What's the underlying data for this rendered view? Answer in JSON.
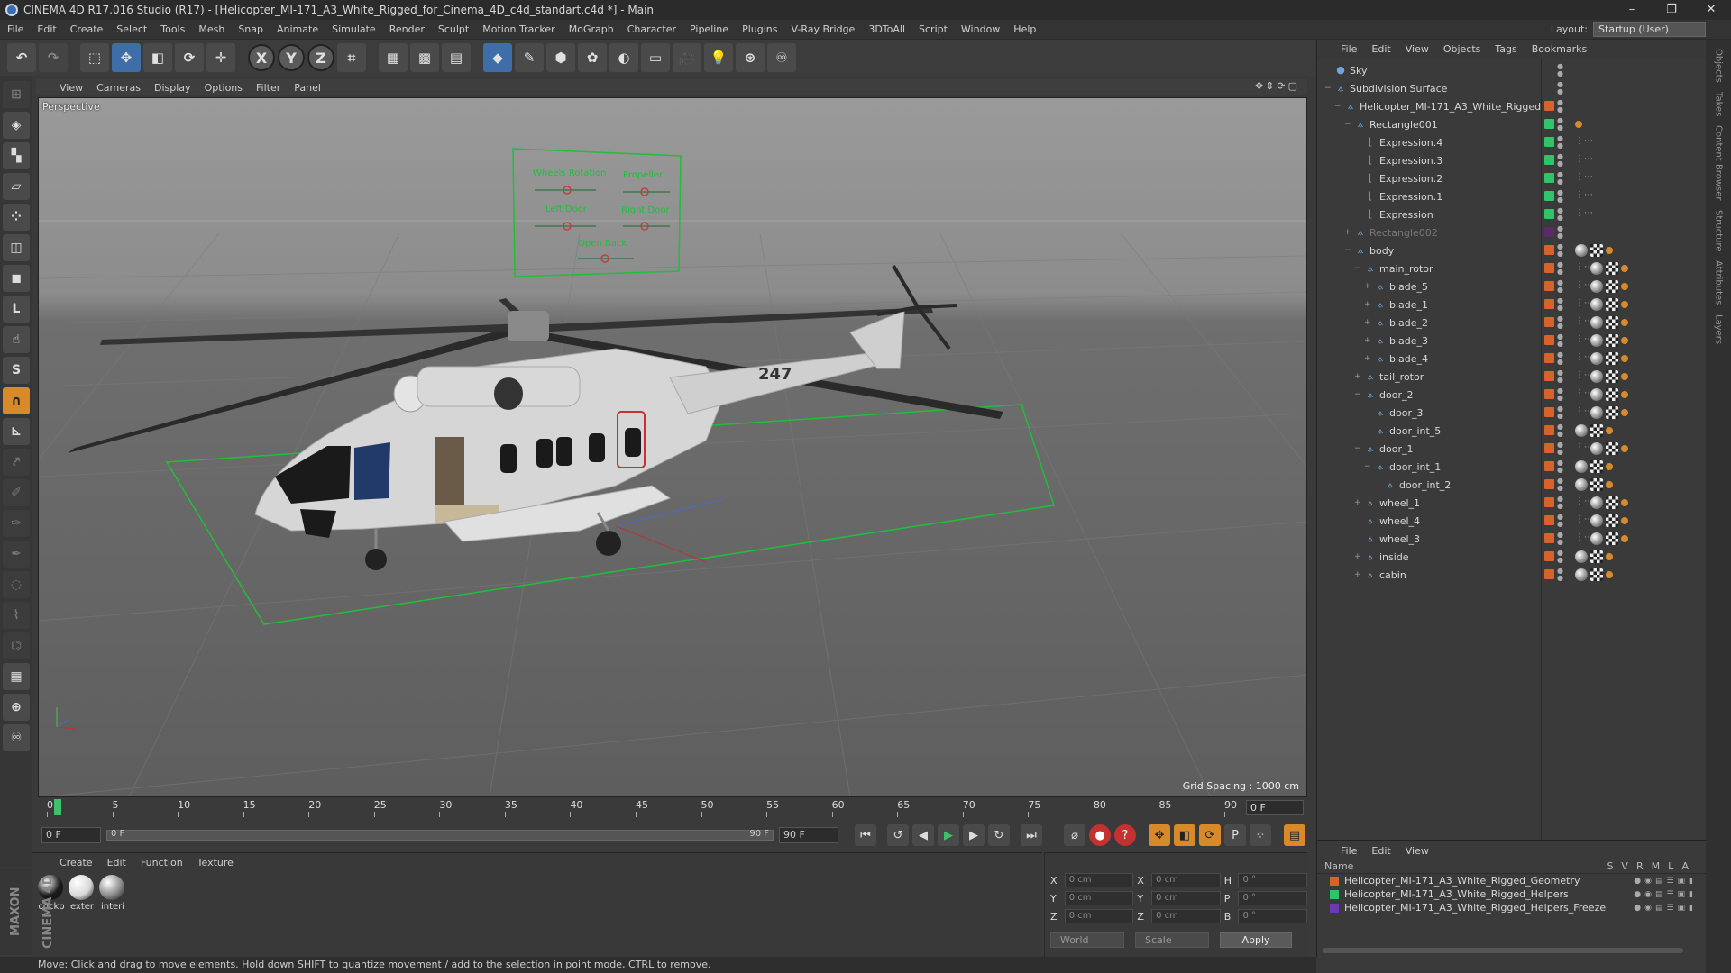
{
  "titlebar": {
    "title": "CINEMA 4D R17.016 Studio (R17) - [Helicopter_MI-171_A3_White_Rigged_for_Cinema_4D_c4d_standart.c4d *] - Main"
  },
  "menubar": {
    "items": [
      "File",
      "Edit",
      "Create",
      "Select",
      "Tools",
      "Mesh",
      "Snap",
      "Animate",
      "Simulate",
      "Render",
      "Sculpt",
      "Motion Tracker",
      "MoGraph",
      "Character",
      "Pipeline",
      "Plugins",
      "V-Ray Bridge",
      "3DToAll",
      "Script",
      "Window",
      "Help"
    ],
    "layout_label": "Layout:",
    "layout_value": "Startup (User)"
  },
  "toolbar": {
    "axis_x": "X",
    "axis_y": "Y",
    "axis_z": "Z"
  },
  "viewport": {
    "menu": [
      "View",
      "Cameras",
      "Display",
      "Options",
      "Filter",
      "Panel"
    ],
    "label": "Perspective",
    "grid_spacing": "Grid Spacing : 1000 cm",
    "rig_labels": [
      "Wheels Rotation",
      "Propeller",
      "Left Door",
      "Right Door",
      "Open Back"
    ],
    "tail_number": "247",
    "colors": {
      "grid_green": "#1fbf3a",
      "hud_green": "#1fbf3a"
    }
  },
  "timeline": {
    "ticks": [
      "0",
      "5",
      "10",
      "15",
      "20",
      "25",
      "30",
      "35",
      "40",
      "45",
      "50",
      "55",
      "60",
      "65",
      "70",
      "75",
      "80",
      "85",
      "90"
    ],
    "current_frame": "0 F"
  },
  "transport": {
    "start_field": "0 F",
    "slider_start": "0 F",
    "slider_end": "90 F",
    "end_field": "90 F"
  },
  "materials": {
    "menu": [
      "Create",
      "Edit",
      "Function",
      "Texture"
    ],
    "items": [
      {
        "label": "cockp",
        "color": "#1a1a1a"
      },
      {
        "label": "exter",
        "color": "#d8d8d8"
      },
      {
        "label": "interi",
        "color": "#8a8a8a"
      }
    ]
  },
  "coordinates": {
    "rows": [
      {
        "a": "X",
        "av": "0 cm",
        "b": "X",
        "bv": "0 cm",
        "c": "H",
        "cv": "0 °"
      },
      {
        "a": "Y",
        "av": "0 cm",
        "b": "Y",
        "bv": "0 cm",
        "c": "P",
        "cv": "0 °"
      },
      {
        "a": "Z",
        "av": "0 cm",
        "b": "Z",
        "bv": "0 cm",
        "c": "B",
        "cv": "0 °"
      }
    ],
    "mode": "World",
    "scale": "Scale",
    "apply": "Apply"
  },
  "status": {
    "text": "Move: Click and drag to move elements. Hold down SHIFT to quantize movement / add to the selection in point mode, CTRL to remove."
  },
  "brand": {
    "text": "MAXON CINEMA 4D"
  },
  "objects": {
    "menu": [
      "File",
      "Edit",
      "View",
      "Objects",
      "Tags",
      "Bookmarks"
    ],
    "rows": [
      {
        "name": "Sky",
        "indent": 0,
        "exp": "",
        "swatch": "",
        "dim": false,
        "tags": []
      },
      {
        "name": "Subdivision Surface",
        "indent": 0,
        "exp": "−",
        "swatch": "",
        "dim": false,
        "tags": []
      },
      {
        "name": "Helicopter_MI-171_A3_White_Rigged",
        "indent": 1,
        "exp": "−",
        "swatch": "#d8632a",
        "dim": false,
        "tags": []
      },
      {
        "name": "Rectangle001",
        "indent": 2,
        "exp": "−",
        "swatch": "#2fc46a",
        "dim": false,
        "tags": [
          "ph"
        ]
      },
      {
        "name": "Expression.4",
        "indent": 3,
        "exp": "",
        "swatch": "#2fc46a",
        "dim": false,
        "tags": [
          "expr"
        ]
      },
      {
        "name": "Expression.3",
        "indent": 3,
        "exp": "",
        "swatch": "#2fc46a",
        "dim": false,
        "tags": [
          "expr"
        ]
      },
      {
        "name": "Expression.2",
        "indent": 3,
        "exp": "",
        "swatch": "#2fc46a",
        "dim": false,
        "tags": [
          "expr"
        ]
      },
      {
        "name": "Expression.1",
        "indent": 3,
        "exp": "",
        "swatch": "#2fc46a",
        "dim": false,
        "tags": [
          "expr"
        ]
      },
      {
        "name": "Expression",
        "indent": 3,
        "exp": "",
        "swatch": "#2fc46a",
        "dim": false,
        "tags": [
          "expr"
        ]
      },
      {
        "name": "Rectangle002",
        "indent": 2,
        "exp": "+",
        "swatch": "#5a2a6a",
        "dim": true,
        "tags": []
      },
      {
        "name": "body",
        "indent": 2,
        "exp": "−",
        "swatch": "#d8632a",
        "dim": false,
        "tags": [
          "mat",
          "chk",
          "ph"
        ]
      },
      {
        "name": "main_rotor",
        "indent": 3,
        "exp": "−",
        "swatch": "#d8632a",
        "dim": false,
        "tags": [
          "expr",
          "mat",
          "chk",
          "ph"
        ]
      },
      {
        "name": "blade_5",
        "indent": 4,
        "exp": "+",
        "swatch": "#d8632a",
        "dim": false,
        "tags": [
          "expr",
          "mat",
          "chk",
          "ph"
        ]
      },
      {
        "name": "blade_1",
        "indent": 4,
        "exp": "+",
        "swatch": "#d8632a",
        "dim": false,
        "tags": [
          "expr",
          "mat",
          "chk",
          "ph"
        ]
      },
      {
        "name": "blade_2",
        "indent": 4,
        "exp": "+",
        "swatch": "#d8632a",
        "dim": false,
        "tags": [
          "expr",
          "mat",
          "chk",
          "ph"
        ]
      },
      {
        "name": "blade_3",
        "indent": 4,
        "exp": "+",
        "swatch": "#d8632a",
        "dim": false,
        "tags": [
          "expr",
          "mat",
          "chk",
          "ph"
        ]
      },
      {
        "name": "blade_4",
        "indent": 4,
        "exp": "+",
        "swatch": "#d8632a",
        "dim": false,
        "tags": [
          "expr",
          "mat",
          "chk",
          "ph"
        ]
      },
      {
        "name": "tail_rotor",
        "indent": 3,
        "exp": "+",
        "swatch": "#d8632a",
        "dim": false,
        "tags": [
          "expr",
          "mat",
          "chk",
          "ph"
        ]
      },
      {
        "name": "door_2",
        "indent": 3,
        "exp": "−",
        "swatch": "#d8632a",
        "dim": false,
        "tags": [
          "expr",
          "mat",
          "chk",
          "ph"
        ]
      },
      {
        "name": "door_3",
        "indent": 4,
        "exp": "",
        "swatch": "#d8632a",
        "dim": false,
        "tags": [
          "expr",
          "mat",
          "chk",
          "ph"
        ]
      },
      {
        "name": "door_int_5",
        "indent": 4,
        "exp": "",
        "swatch": "#d8632a",
        "dim": false,
        "tags": [
          "mat",
          "chk",
          "ph"
        ]
      },
      {
        "name": "door_1",
        "indent": 3,
        "exp": "−",
        "swatch": "#d8632a",
        "dim": false,
        "tags": [
          "expr",
          "mat",
          "chk",
          "ph"
        ]
      },
      {
        "name": "door_int_1",
        "indent": 4,
        "exp": "−",
        "swatch": "#d8632a",
        "dim": false,
        "tags": [
          "mat",
          "chk",
          "ph"
        ]
      },
      {
        "name": "door_int_2",
        "indent": 5,
        "exp": "",
        "swatch": "#d8632a",
        "dim": false,
        "tags": [
          "mat",
          "chk",
          "ph"
        ]
      },
      {
        "name": "wheel_1",
        "indent": 3,
        "exp": "+",
        "swatch": "#d8632a",
        "dim": false,
        "tags": [
          "expr",
          "mat",
          "chk",
          "ph"
        ]
      },
      {
        "name": "wheel_4",
        "indent": 3,
        "exp": "",
        "swatch": "#d8632a",
        "dim": false,
        "tags": [
          "expr",
          "mat",
          "chk",
          "ph"
        ]
      },
      {
        "name": "wheel_3",
        "indent": 3,
        "exp": "",
        "swatch": "#d8632a",
        "dim": false,
        "tags": [
          "expr",
          "mat",
          "chk",
          "ph"
        ]
      },
      {
        "name": "inside",
        "indent": 3,
        "exp": "+",
        "swatch": "#d8632a",
        "dim": false,
        "tags": [
          "mat",
          "chk",
          "ph"
        ]
      },
      {
        "name": "cabin",
        "indent": 3,
        "exp": "+",
        "swatch": "#d8632a",
        "dim": false,
        "tags": [
          "mat",
          "chk",
          "ph"
        ]
      }
    ]
  },
  "layers": {
    "menu": [
      "File",
      "Edit",
      "View"
    ],
    "name_header": "Name",
    "col_headers": "SVRMLA",
    "rows": [
      {
        "name": "Helicopter_MI-171_A3_White_Rigged_Geometry",
        "color": "#d8632a"
      },
      {
        "name": "Helicopter_MI-171_A3_White_Rigged_Helpers",
        "color": "#2fc46a"
      },
      {
        "name": "Helicopter_MI-171_A3_White_Rigged_Helpers_Freeze",
        "color": "#6a3ab4"
      }
    ]
  },
  "rightstrip": [
    "Objects",
    "Takes",
    "Content Browser",
    "Structure",
    "Attributes",
    "Layers"
  ]
}
